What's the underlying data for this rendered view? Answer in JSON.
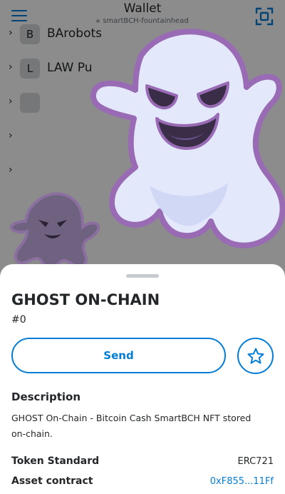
{
  "header": {
    "title": "Wallet",
    "network": "smartBCH-fountainhead"
  },
  "collectibles": [
    {
      "badge": "B",
      "name": "BArobots"
    },
    {
      "badge": "L",
      "name": "LAW Pu"
    },
    {
      "badge": "",
      "name": ""
    },
    {
      "badge": "",
      "name": ""
    },
    {
      "badge": "",
      "name": ""
    }
  ],
  "nft": {
    "name": "GHOST ON-CHAIN",
    "token_id": "#0",
    "send_label": "Send",
    "description_title": "Description",
    "description": "GHOST On-Chain - Bitcoin Cash SmartBCH NFT stored on-chain.",
    "token_standard_label": "Token Standard",
    "token_standard": "ERC721",
    "asset_contract_label": "Asset contract",
    "asset_contract": "0xF855...11Ff"
  },
  "colors": {
    "accent": "#037dd6",
    "ghost_body": "#e3e8fb",
    "ghost_outline": "#9a6bb5"
  }
}
